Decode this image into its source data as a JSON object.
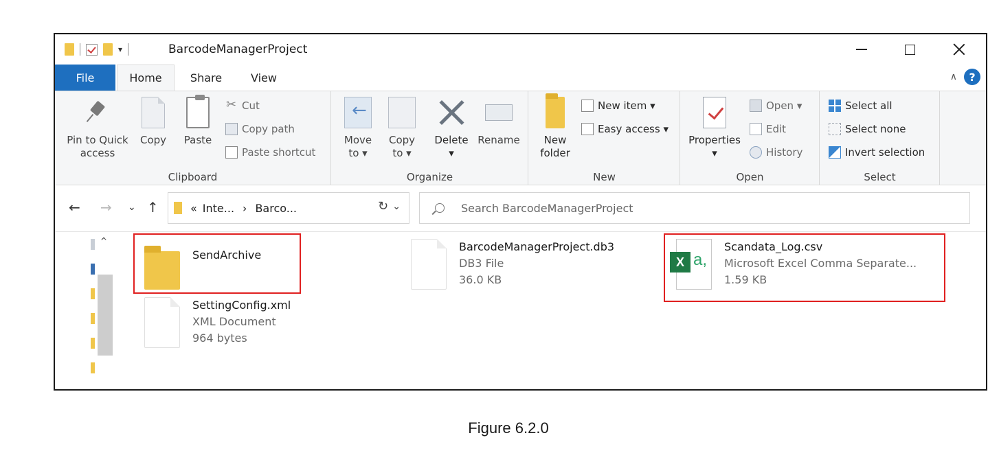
{
  "window": {
    "title": "BarcodeManagerProject",
    "qat_dropdown": "▾",
    "minimize_glyph": "",
    "maximize_glyph": "",
    "close_glyph": ""
  },
  "tabs": [
    {
      "label": "File"
    },
    {
      "label": "Home"
    },
    {
      "label": "Share"
    },
    {
      "label": "View"
    }
  ],
  "help": {
    "chevron": "∧",
    "label": "?"
  },
  "ribbon": {
    "clipboard": {
      "group_label": "Clipboard",
      "pin_line1": "Pin to Quick",
      "pin_line2": "access",
      "copy": "Copy",
      "paste": "Paste",
      "cut": "Cut",
      "copy_path": "Copy path",
      "paste_shortcut": "Paste shortcut"
    },
    "organize": {
      "group_label": "Organize",
      "move_line1": "Move",
      "move_line2": "to ▾",
      "copy_line1": "Copy",
      "copy_line2": "to ▾",
      "delete": "Delete",
      "delete_dd": "▾",
      "rename": "Rename"
    },
    "new": {
      "group_label": "New",
      "new_folder_line1": "New",
      "new_folder_line2": "folder",
      "new_item": "New item ▾",
      "easy_access": "Easy access ▾"
    },
    "open": {
      "group_label": "Open",
      "properties": "Properties",
      "properties_dd": "▾",
      "open": "Open ▾",
      "edit": "Edit",
      "history": "History"
    },
    "select": {
      "group_label": "Select",
      "select_all": "Select all",
      "select_none": "Select none",
      "invert_selection": "Invert selection"
    }
  },
  "address": {
    "back": "←",
    "forward": "→",
    "recent": "⌄",
    "up": "↑",
    "crumbs_prefix": "«",
    "crumb1": "Inte...",
    "crumb_sep": "›",
    "crumb2": "Barco...",
    "dropdown": "⌄",
    "refresh": "↻",
    "search_placeholder": "Search BarcodeManagerProject"
  },
  "navpane": {
    "scroll_up": "^"
  },
  "files": [
    {
      "name": "SendArchive",
      "type": "",
      "size": "",
      "icon": "folder-icon"
    },
    {
      "name": "BarcodeManagerProject.db3",
      "type": "DB3 File",
      "size": "36.0 KB",
      "icon": "document-icon"
    },
    {
      "name": "Scandata_Log.csv",
      "type": "Microsoft Excel Comma Separate...",
      "size": "1.59 KB",
      "icon": "excel-csv-icon"
    },
    {
      "name": "SettingConfig.xml",
      "type": "XML Document",
      "size": "964 bytes",
      "icon": "document-icon"
    }
  ],
  "excel_badge": {
    "x": "X",
    "a": "a,"
  },
  "highlight_color": "#e02020",
  "accent_color": "#1e6fbf",
  "caption": "Figure 6.2.0"
}
